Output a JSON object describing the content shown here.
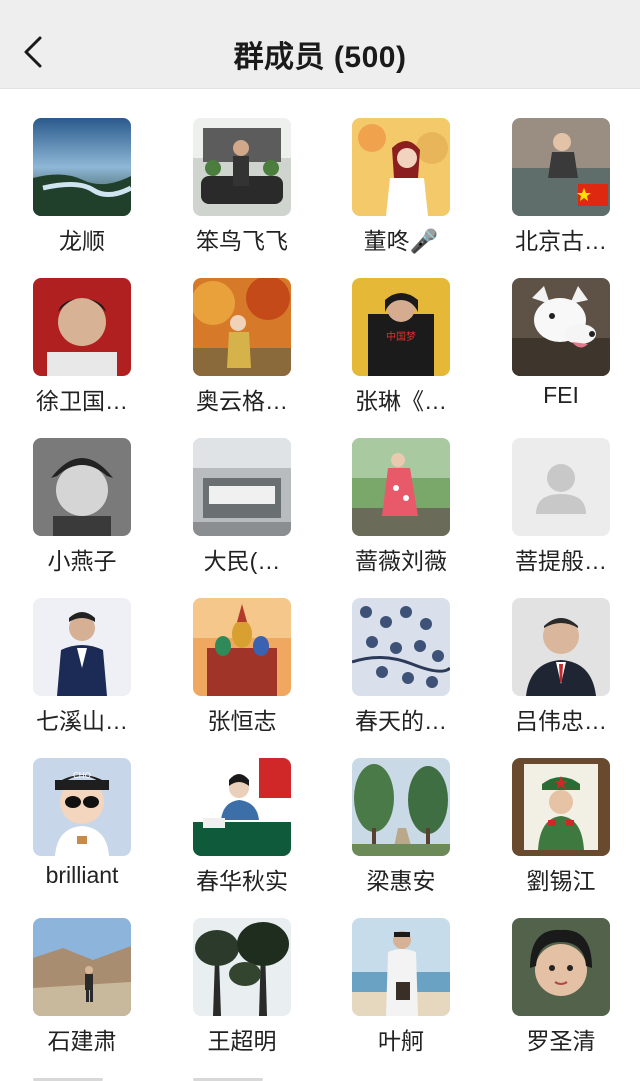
{
  "header": {
    "title": "群成员 (500)",
    "back_icon": "chevron-left-icon",
    "background": "#eeeeee"
  },
  "members": [
    {
      "name": "龙顺",
      "avatar": "river-landscape"
    },
    {
      "name": "笨鸟飞飞",
      "avatar": "man-with-car"
    },
    {
      "name": "董咚🎤",
      "avatar": "woman-autumn-leaves"
    },
    {
      "name": "北京古…",
      "avatar": "woman-with-flag",
      "badge": "china-flag-icon"
    },
    {
      "name": "徐卫国…",
      "avatar": "man-portrait-red"
    },
    {
      "name": "奥云格…",
      "avatar": "woman-autumn-forest"
    },
    {
      "name": "张琳《…",
      "avatar": "singer-poster"
    },
    {
      "name": "FEI",
      "avatar": "white-dog"
    },
    {
      "name": "小燕子",
      "avatar": "bw-woman-portrait"
    },
    {
      "name": "大民(…",
      "avatar": "loom-factory"
    },
    {
      "name": "蔷薇刘薇",
      "avatar": "woman-garden"
    },
    {
      "name": "菩提般…",
      "avatar": "default-avatar"
    },
    {
      "name": "七溪山…",
      "avatar": "man-in-suit"
    },
    {
      "name": "张恒志",
      "avatar": "cathedral"
    },
    {
      "name": "春天的…",
      "avatar": "blue-pattern"
    },
    {
      "name": "吕伟忠…",
      "avatar": "man-suit-portrait"
    },
    {
      "name": "brilliant",
      "avatar": "cartoon-boy"
    },
    {
      "name": "春华秋实",
      "avatar": "woman-at-desk"
    },
    {
      "name": "梁惠安",
      "avatar": "trees-path"
    },
    {
      "name": "劉锡江",
      "avatar": "soldier-portrait"
    },
    {
      "name": "石建肃",
      "avatar": "man-in-canyon"
    },
    {
      "name": "王超明",
      "avatar": "pine-trees"
    },
    {
      "name": "叶舸",
      "avatar": "man-on-beach"
    },
    {
      "name": "罗圣清",
      "avatar": "woman-vintage-portrait"
    }
  ]
}
